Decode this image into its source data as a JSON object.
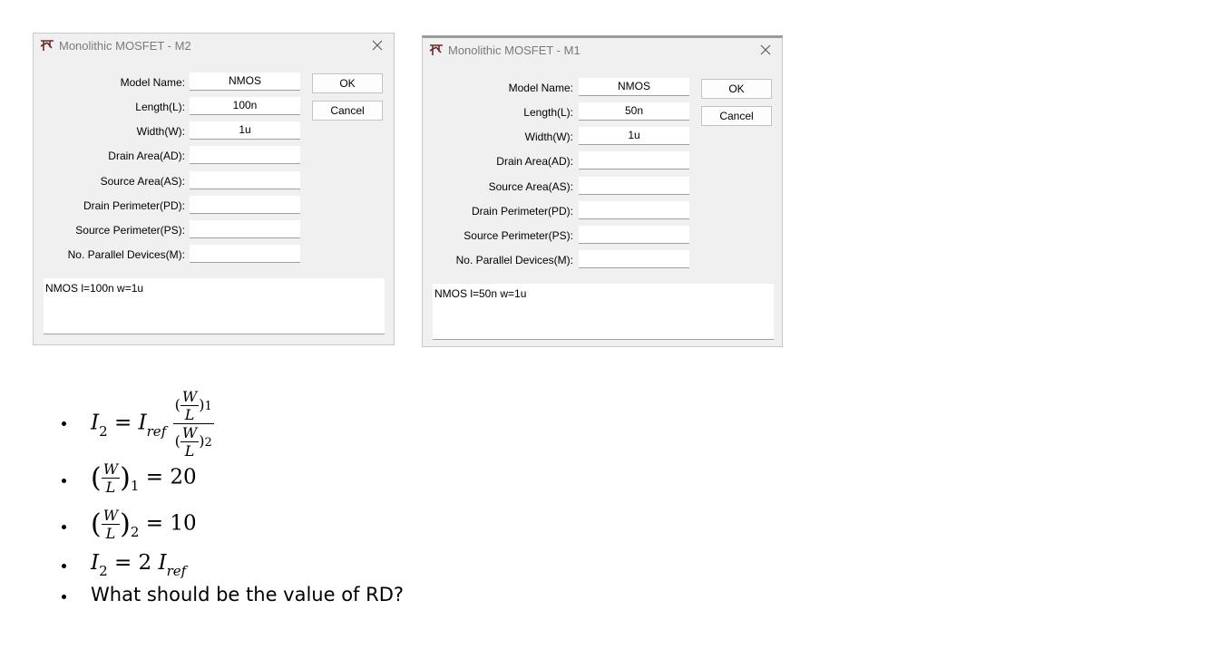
{
  "dialogs": {
    "m2": {
      "title": "Monolithic MOSFET - M2",
      "fields": [
        {
          "label": "Model Name:",
          "value": "NMOS"
        },
        {
          "label": "Length(L):",
          "value": "100n"
        },
        {
          "label": "Width(W):",
          "value": "1u"
        },
        {
          "label": "Drain Area(AD):",
          "value": ""
        },
        {
          "label": "Source Area(AS):",
          "value": ""
        },
        {
          "label": "Drain Perimeter(PD):",
          "value": ""
        },
        {
          "label": "Source Perimeter(PS):",
          "value": ""
        },
        {
          "label": "No. Parallel Devices(M):",
          "value": ""
        }
      ],
      "ok_label": "OK",
      "cancel_label": "Cancel",
      "description": "NMOS l=100n w=1u"
    },
    "m1": {
      "title": "Monolithic MOSFET - M1",
      "fields": [
        {
          "label": "Model Name:",
          "value": "NMOS"
        },
        {
          "label": "Length(L):",
          "value": "50n"
        },
        {
          "label": "Width(W):",
          "value": "1u"
        },
        {
          "label": "Drain Area(AD):",
          "value": ""
        },
        {
          "label": "Source Area(AS):",
          "value": ""
        },
        {
          "label": "Drain Perimeter(PD):",
          "value": ""
        },
        {
          "label": "Source Perimeter(PS):",
          "value": ""
        },
        {
          "label": "No. Parallel Devices(M):",
          "value": ""
        }
      ],
      "ok_label": "OK",
      "cancel_label": "Cancel",
      "description": "NMOS l=50n w=1u"
    }
  },
  "notes": {
    "eq1": {
      "lhs": "I",
      "lhs_sub": "2",
      "eq": "=",
      "rhs": "I",
      "rhs_sub": "ref",
      "num_w": "W",
      "num_l": "L",
      "num_sub": "1",
      "den_w": "W",
      "den_l": "L",
      "den_sub": "2"
    },
    "eq2": {
      "w": "W",
      "l": "L",
      "sub": "1",
      "rhs": "= 20"
    },
    "eq3": {
      "w": "W",
      "l": "L",
      "sub": "2",
      "rhs": "= 10"
    },
    "eq4": {
      "lhs": "I",
      "lhs_sub": "2",
      "rhs": "= 2",
      "rhs_var": "I",
      "rhs_sub": "ref"
    },
    "question": "What should be the value of RD?"
  }
}
